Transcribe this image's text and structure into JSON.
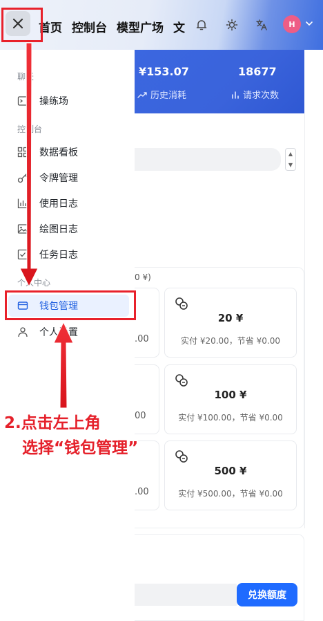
{
  "header": {
    "close_icon": "close-icon",
    "nav_items": [
      "首页",
      "控制台",
      "模型广场",
      "文"
    ],
    "icons": [
      "bell-icon",
      "sun-icon",
      "translate-icon"
    ],
    "avatar_letter": "H",
    "avatar_color": "#ee5d86"
  },
  "stats": {
    "history_spend_value": "¥153.07",
    "history_spend_label": "历史消耗",
    "request_count_value": "18677",
    "request_count_label": "请求次数"
  },
  "sidebar": {
    "sections": [
      {
        "title": "聊天",
        "items": [
          {
            "label": "操练场",
            "icon": "terminal-icon"
          }
        ]
      },
      {
        "title": "控制台",
        "items": [
          {
            "label": "数据看板",
            "icon": "dashboard-icon"
          },
          {
            "label": "令牌管理",
            "icon": "key-icon"
          },
          {
            "label": "使用日志",
            "icon": "bar-chart-icon"
          },
          {
            "label": "绘图日志",
            "icon": "image-icon"
          },
          {
            "label": "任务日志",
            "icon": "checkbox-icon"
          }
        ]
      },
      {
        "title": "个人中心",
        "items": [
          {
            "label": "钱包管理",
            "icon": "wallet-icon",
            "active": true
          },
          {
            "label": "个人设置",
            "icon": "user-icon"
          }
        ]
      }
    ]
  },
  "main": {
    "partial_hint": "0 ¥)",
    "left_fragments": [
      ".00",
      "00",
      ".00"
    ],
    "recharge_options": [
      {
        "amount": "20 ¥",
        "detail": "实付 ¥20.00，节省 ¥0.00"
      },
      {
        "amount": "100 ¥",
        "detail": "实付 ¥100.00，节省 ¥0.00"
      },
      {
        "amount": "500 ¥",
        "detail": "实付 ¥500.00，节省 ¥0.00"
      }
    ],
    "redeem_button": "兑换额度"
  },
  "annotation": {
    "line1": "2.点击左上角",
    "line2": "选择“钱包管理”",
    "color": "#e5202a"
  },
  "colors": {
    "accent": "#1f6bff",
    "banner": "#3a63db",
    "active_bg": "#eaf1ff"
  }
}
